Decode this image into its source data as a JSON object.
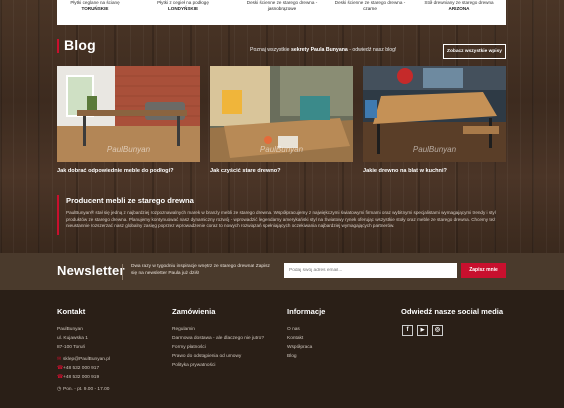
{
  "products": [
    {
      "line1": "Płytki ceglane na ścianę",
      "line2": "TORUŃSKIE"
    },
    {
      "line1": "Płytki z cegieł na podłogę",
      "line2": "LONDYŃSKIE"
    },
    {
      "line1": "Deski ścienne ze starego drewna -",
      "line2": "jasnobrązowe"
    },
    {
      "line1": "Deski ścienne ze starego drewna -",
      "line2": "czarne"
    },
    {
      "line1": "Stół drewniany ze starego drewna",
      "line2": "ARIZONA"
    }
  ],
  "blog": {
    "title": "Blog",
    "desc_prefix": "Poznaj wszystkie ",
    "desc_bold": "sekrety Paula Bunyana",
    "desc_suffix": " - odwiedź nasz blog!",
    "button": "Zobacz wszystkie wpisy",
    "posts": [
      {
        "title": "Jak dobrać odpowiednie meble do podłogi?",
        "watermark": "PaulBunyan"
      },
      {
        "title": "Jak czyścić stare drewno?",
        "watermark": "PaulBunyan"
      },
      {
        "title": "Jakie drewno na blat w kuchni?",
        "watermark": "PaulBunyan"
      }
    ]
  },
  "producer": {
    "title": "Producent mebli ze starego drewna",
    "text": "PaulBunyan® stał się jedną z najbardziej rozpoznawalnych marek w branży mebli ze starego drewna. Współpracujemy z najwiękczymi światowymi firmami oraz wybitnymi specjalistami wymagającymi trendy i styl produktów ze starego drewna. Planujemy kontynuować nasz dynamiczny rozwój - wprowadzić legendarny amerykański styl na Światowy rynek oferując wszystkie stoły oraz meble ze starego drewna. Chcemy też nieustannie rozszerzać nasz globalny zasięg poprzez wprowadzenie coraz to nowych rozwiązań spełniających oczekiwania najbardziej wymagających partnerów."
  },
  "newsletter": {
    "title": "Newsletter",
    "text": "Dwa razy w tygodniu inspiracje wnętrz ze starego drewna! Zapisz się na newsletter Paula już dziś!",
    "placeholder": "Podaj swój adres email...",
    "button": "Zapisz mnie"
  },
  "footer": {
    "contact": {
      "title": "Kontakt",
      "lines": [
        "PaulBunyan",
        "ul. Kujawska 1",
        "87-100 Toruń"
      ],
      "email": "sklep@PaulBunyan.pl",
      "phone1": "+48 532 000 917",
      "phone2": "+48 532 000 919",
      "hours": "Pon. - pt. 9.00 - 17.00"
    },
    "orders": {
      "title": "Zamówienia",
      "links": [
        "Regulamin",
        "Darmowa dostawa - ale dlaczego nie jutro?",
        "Formy płatności",
        "Prawo do odstąpienia od umowy",
        "Polityka prywatności"
      ]
    },
    "info": {
      "title": "Informacje",
      "links": [
        "O nas",
        "Kontakt",
        "Współpraca",
        "Blog"
      ]
    },
    "social": {
      "title": "Odwiedź nasze social media",
      "icons": [
        "facebook-icon",
        "youtube-icon",
        "instagram-icon"
      ]
    }
  },
  "colors": {
    "accent": "#c8102e",
    "footer_bg": "#2a1f17",
    "newsletter_bg": "#4a3a2c"
  }
}
